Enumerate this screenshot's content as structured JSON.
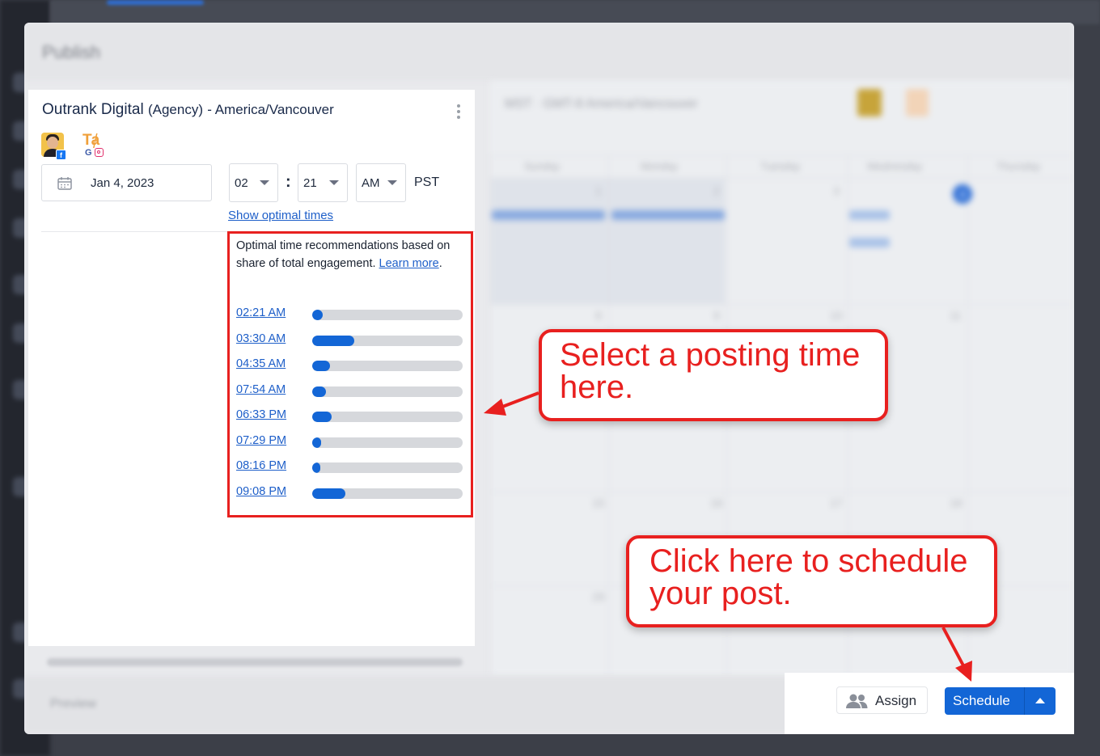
{
  "modal": {
    "title": "Publish",
    "footer_left": "Preview"
  },
  "calendar": {
    "header": "MST · GMT-8 America/Vancouver",
    "days": [
      "Sunday",
      "Monday",
      "Tuesday",
      "Wednesday",
      "Thursday"
    ],
    "week1": [
      "1",
      "2",
      "3",
      "4"
    ],
    "week2": [
      "8",
      "9",
      "10",
      "11"
    ],
    "week3": [
      "15",
      "16",
      "17",
      "18"
    ],
    "week4": [
      "22",
      "23",
      "24",
      "25"
    ],
    "week5": [
      "29"
    ]
  },
  "account": {
    "name": "Outrank Digital",
    "type": "(Agency)",
    "timezone": "- America/Vancouver"
  },
  "schedule": {
    "date": "Jan 4, 2023",
    "hour": "02",
    "colon": ":",
    "minute": "21",
    "ampm": "AM",
    "tz": "PST"
  },
  "optimal": {
    "link_label": "Show optimal times",
    "intro": "Optimal time recommendations based on share of total engagement.",
    "learn_more": "Learn more",
    "period": ".",
    "times": [
      {
        "label": "02:21 AM",
        "share": 0.07
      },
      {
        "label": "03:30 AM",
        "share": 0.28
      },
      {
        "label": "04:35 AM",
        "share": 0.12
      },
      {
        "label": "07:54 AM",
        "share": 0.09
      },
      {
        "label": "06:33 PM",
        "share": 0.13
      },
      {
        "label": "07:29 PM",
        "share": 0.06
      },
      {
        "label": "08:16 PM",
        "share": 0.04
      },
      {
        "label": "09:08 PM",
        "share": 0.22
      }
    ]
  },
  "footer": {
    "assign_label": "Assign",
    "schedule_label": "Schedule"
  },
  "annotations": {
    "callout1_line1": "Select a posting time",
    "callout1_line2": "here.",
    "callout2_line1": "Click here to schedule",
    "callout2_line2": "your post."
  },
  "colors": {
    "accent": "#1366d6",
    "annotation": "#e8201f",
    "track": "#d6d8dc"
  }
}
